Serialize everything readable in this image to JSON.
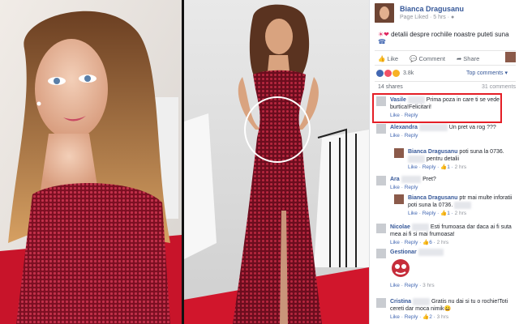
{
  "post": {
    "page_name": "Bianca Dragusanu",
    "meta": "Page Liked · 5 hrs · ",
    "text": "detalii despre rochiile noastre puteti suna",
    "emoji_prefix": "☀❤",
    "actions": {
      "like": "Like",
      "comment": "Comment",
      "share": "Share"
    },
    "reaction_count": "3.8k",
    "top_comments": "Top comments ▾",
    "shares": "14 shares",
    "comments": "31 comments"
  },
  "comments": [
    {
      "name": "Vasile",
      "text": "Prima poza in care ti se vede burtica!Felicitari!",
      "like": "Like",
      "reply": "Reply",
      "highlighted": true
    },
    {
      "name": "Alexandra",
      "text": "Un pret va rog ???",
      "like": "Like",
      "reply": "Reply"
    },
    {
      "name": "Bianca Dragusanu",
      "text": "poti suna la 0736.",
      "text2": "pentru detalii",
      "like": "Like",
      "reply": "Reply",
      "likes": "1",
      "time": "2 hrs",
      "reply_of": true
    },
    {
      "name": "Ara",
      "text": "Pret?",
      "like": "Like",
      "reply": "Reply"
    },
    {
      "name": "Bianca Dragusanu",
      "text": "ptr mai multe inforatii poti suna la 0736.",
      "like": "Like",
      "reply": "Reply",
      "likes": "1",
      "time": "2 hrs",
      "reply_of": true
    },
    {
      "name": "Nicolae",
      "text": "Esti frumoasa dar daca ai fi suta mea ai fi si mai frumoasa!",
      "like": "Like",
      "reply": "Reply",
      "likes": "6",
      "time": "2 hrs"
    },
    {
      "name": "Gestionar",
      "text": "",
      "like": "Like",
      "reply": "Reply",
      "likes": "",
      "time": "3 hrs"
    },
    {
      "name": "Cristina",
      "text": "Gratis nu dai si tu o rochie!Toti cereti dar moca nimik😀",
      "like": "Like",
      "reply": "Reply",
      "likes": "2",
      "time": "3 hrs"
    }
  ],
  "colors": {
    "accent": "#365899",
    "highlight": "#e41e26",
    "dress": "#8b1a2b"
  }
}
